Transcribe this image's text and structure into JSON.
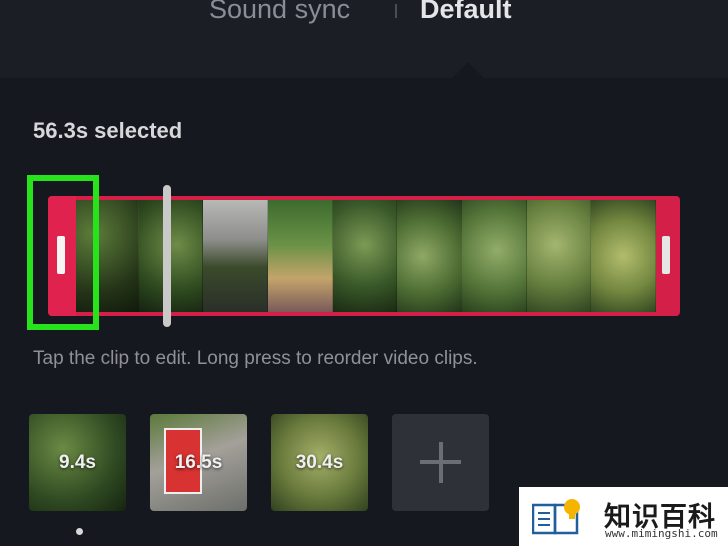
{
  "tabs": [
    {
      "label": "Sound sync",
      "active": false
    },
    {
      "label": "Default",
      "active": true
    }
  ],
  "selection": {
    "label": "56.3s selected"
  },
  "hint_text": "Tap the clip to edit. Long press to reorder video clips.",
  "clips": [
    {
      "duration": "9.4s"
    },
    {
      "duration": "16.5s"
    },
    {
      "duration": "30.4s"
    }
  ],
  "add_clip": {
    "icon": "plus-icon"
  },
  "colors": {
    "accent": "#e0234e",
    "highlight": "#27e31b",
    "background": "#16181f"
  },
  "watermark": {
    "title": "知识百科",
    "url": "www.mimingshi.com"
  }
}
